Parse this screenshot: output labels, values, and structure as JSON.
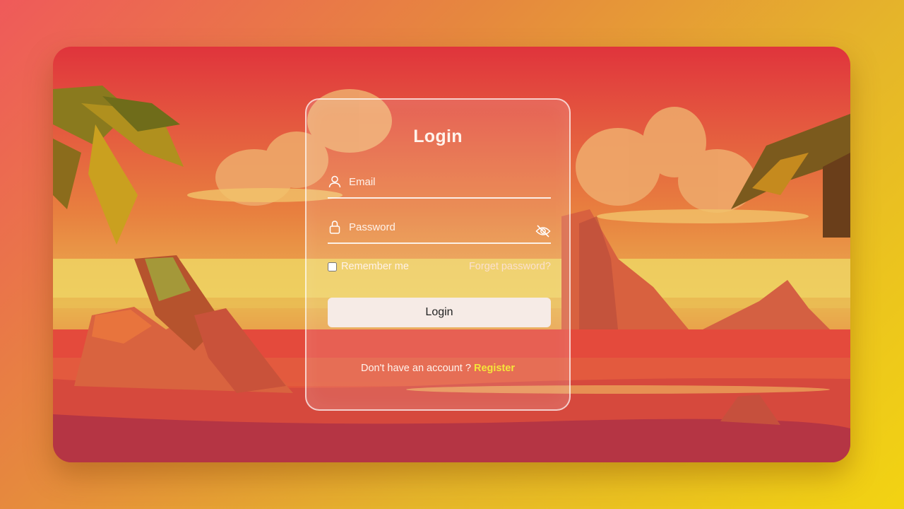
{
  "form": {
    "title": "Login",
    "email_placeholder": "Email",
    "password_placeholder": "Password",
    "remember_label": "Remember me",
    "forgot_label": "Forget password?",
    "submit_label": "Login",
    "no_account_text": "Don't have an account ?",
    "register_label": "Register"
  },
  "icons": {
    "email": "user-icon",
    "password": "lock-icon",
    "toggle": "eye-slash-icon"
  },
  "colors": {
    "register_link": "#f5e53a",
    "button_bg": "#f6ebe6"
  }
}
